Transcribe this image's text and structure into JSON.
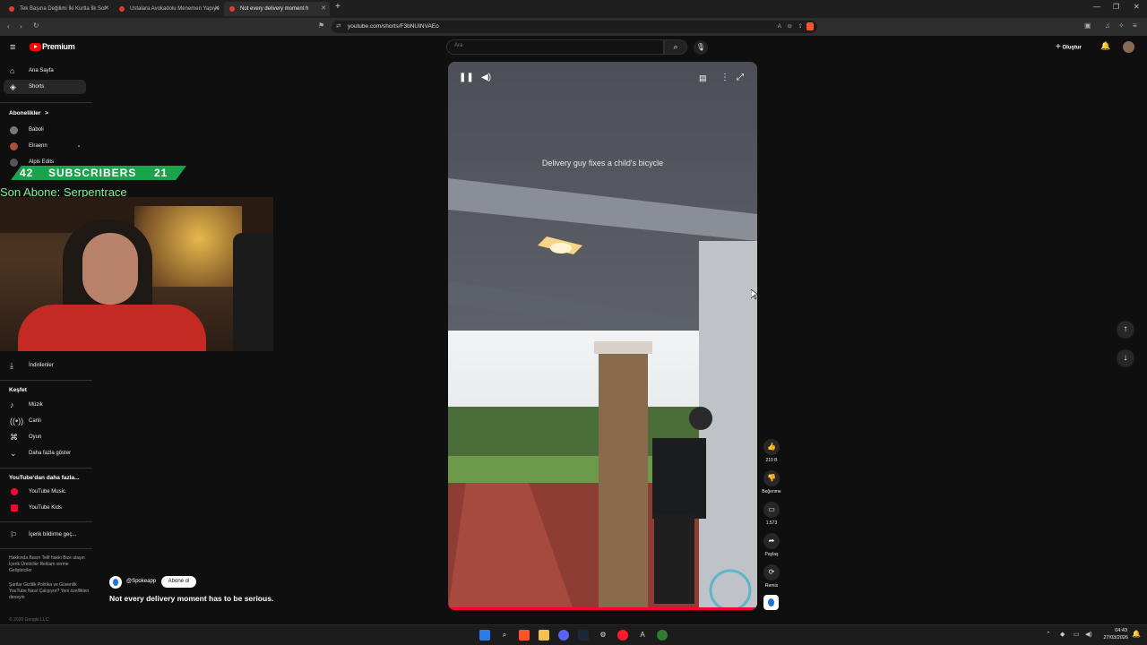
{
  "browser": {
    "tabs": [
      {
        "title": "Tek Başına Değilimi İki Kurtla İlk Sol"
      },
      {
        "title": "Ustalara Avokadolu Menemen Yapıyo"
      },
      {
        "title": "Not every delivery moment h"
      }
    ],
    "new_tab": "+",
    "url": "youtube.com/shorts/F3bNUINVAEo"
  },
  "yt": {
    "logo": "Premium",
    "search_placeholder": "Ara",
    "create_label": "Oluştur",
    "nav": [
      {
        "label": "Ana Sayfa",
        "icon": "home-icon"
      },
      {
        "label": "Shorts",
        "icon": "shorts-icon"
      }
    ],
    "subs_heading": "Abonelikler",
    "subs_arrow": ">",
    "subs": [
      {
        "label": "Baboli"
      },
      {
        "label": "Elraenn"
      },
      {
        "label": "Alpis Edits"
      }
    ],
    "downloads": "İndirilenler",
    "explore_heading": "Keşfet",
    "explore": [
      {
        "label": "Müzik"
      },
      {
        "label": "Canlı"
      },
      {
        "label": "Oyun"
      },
      {
        "label": "Daha fazla göster"
      }
    ],
    "more_heading": "YouTube'dan daha fazla...",
    "more": [
      {
        "label": "YouTube Music"
      },
      {
        "label": "YouTube Kids"
      }
    ],
    "report": "İçerik bildirme geç...",
    "footer1": "Hakkında  Basın  Telif hakkı  Bize ulaşın  İçerik Üreticiler  Reklam verme  Geliştiriciler",
    "footer2": "Şartlar  Gizlilik  Politika ve Güvenlik  YouTube Nasıl Çalışıyor?  Yeni özellikleri deneyin",
    "copyright": "© 2026 Google LLC"
  },
  "overlay": {
    "subs_left": "42",
    "subs_label": "SUBSCRIBERS",
    "subs_right": "21",
    "last_sub": "Son Abone: Serpentrace"
  },
  "short": {
    "caption": "Delivery guy fixes a child's bicycle",
    "channel": "@Spokeapp",
    "subscribe": "Abone ol",
    "title": "Not every delivery moment has to be serious.",
    "likes": "210 B",
    "dislike": "Beğenme",
    "comments": "1.573",
    "share": "Paylaş",
    "remix": "Remix"
  },
  "taskbar": {
    "time": "04:43",
    "date": "27/03/2026"
  }
}
